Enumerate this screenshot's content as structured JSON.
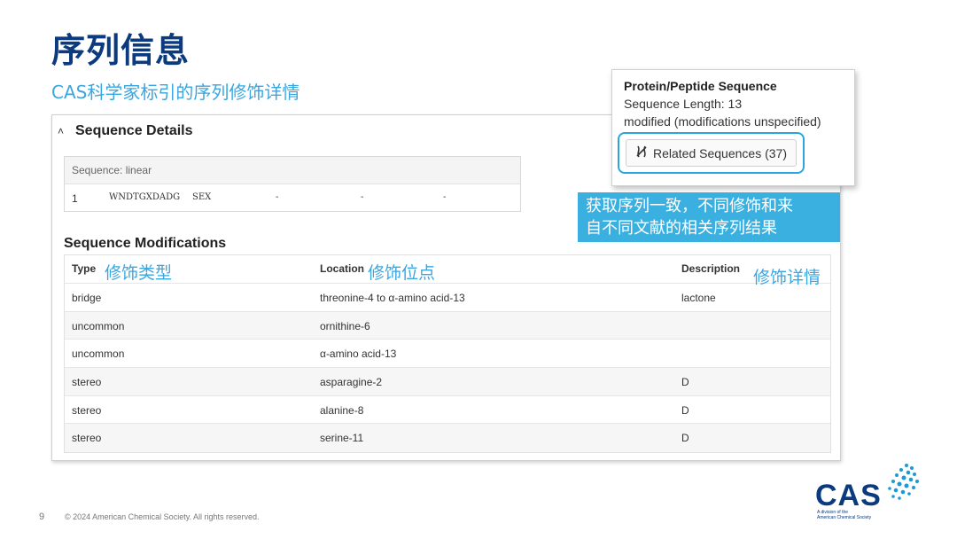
{
  "slide": {
    "title": "序列信息",
    "subtitle": "CAS科学家标引的序列修饰详情",
    "page_number": "9",
    "copyright": "© 2024 American Chemical Society. All rights reserved."
  },
  "panel": {
    "title": "Sequence Details",
    "sequence": {
      "header": "Sequence: linear",
      "row": {
        "num": "1",
        "seq": "WNDTGXDADG",
        "seq2": "SEX",
        "d1": "-",
        "d2": "-",
        "d3": "-"
      }
    },
    "mods_title": "Sequence Modifications",
    "columns": [
      "Type",
      "Location",
      "Description"
    ],
    "annotations": [
      "修饰类型",
      "修饰位点",
      "修饰详情"
    ],
    "rows": [
      {
        "type": "bridge",
        "location": "threonine-4 to α-amino acid-13",
        "description": "lactone"
      },
      {
        "type": "uncommon",
        "location": "ornithine-6",
        "description": ""
      },
      {
        "type": "uncommon",
        "location": "α-amino acid-13",
        "description": ""
      },
      {
        "type": "stereo",
        "location": "asparagine-2",
        "description": "D"
      },
      {
        "type": "stereo",
        "location": "alanine-8",
        "description": "D"
      },
      {
        "type": "stereo",
        "location": "serine-11",
        "description": "D"
      }
    ]
  },
  "popup": {
    "title": "Protein/Peptide Sequence",
    "length": "Sequence Length: 13",
    "modified": "modified (modifications unspecified)",
    "related_label": "Related Sequences (37)"
  },
  "callout": {
    "line1": "获取序列一致，不同修饰和来",
    "line2": "自不同文献的相关序列结果"
  },
  "logo": {
    "text": "CAS",
    "tag1": "A division of the",
    "tag2": "American Chemical Society"
  },
  "colors": {
    "title": "#0b3a7e",
    "accent": "#3aa6e0",
    "callout_bg": "#3ab0e0"
  }
}
